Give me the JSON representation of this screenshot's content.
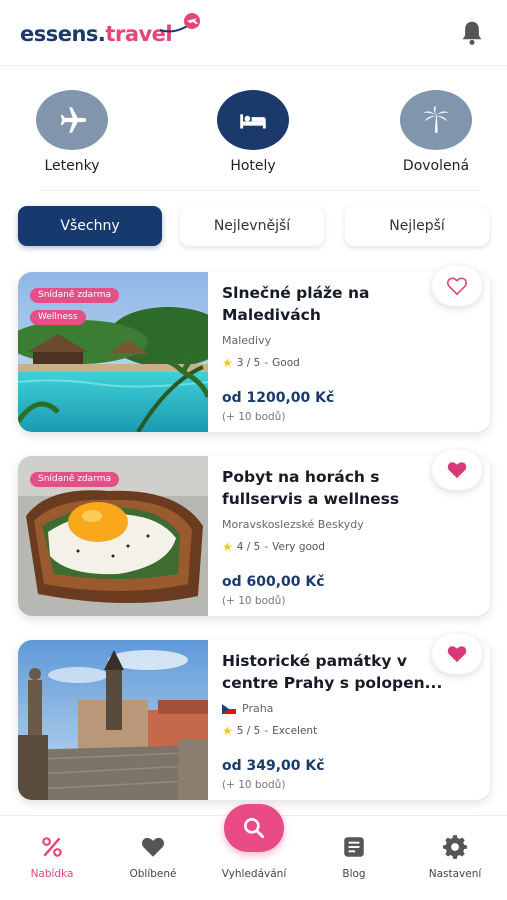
{
  "header": {
    "logo_part1": "essens.",
    "logo_part2": "travel"
  },
  "categories": [
    {
      "label": "Letenky",
      "icon": "airplane-icon",
      "active": false
    },
    {
      "label": "Hotely",
      "icon": "bed-icon",
      "active": true
    },
    {
      "label": "Dovolená",
      "icon": "palm-tree-icon",
      "active": false
    }
  ],
  "filters": [
    {
      "label": "Všechny",
      "active": true
    },
    {
      "label": "Nejlevnější",
      "active": false
    },
    {
      "label": "Nejlepší",
      "active": false
    }
  ],
  "offers": [
    {
      "badges": [
        "Snídaně zdarma",
        "Wellness"
      ],
      "title": "Slnečné pláže na Maledivách",
      "location": "Maledivy",
      "rating": "3 / 5",
      "rating_text": "Good",
      "price": "od 1200,00 Kč",
      "points": "(+ 10 bodů)",
      "favorite": false
    },
    {
      "badges": [
        "Snídaně zdarma"
      ],
      "title": "Pobyt na horách s fullservis a wellness",
      "location": "Moravskoslezské Beskydy",
      "rating": "4 / 5",
      "rating_text": "Very good",
      "price": "od 600,00 Kč",
      "points": "(+ 10 bodů)",
      "favorite": true
    },
    {
      "badges": [],
      "title": "Historické památky v centre Prahy s polopen...",
      "location": "Praha",
      "rating": "5 / 5",
      "rating_text": "Excelent",
      "price": "od 349,00 Kč",
      "points": "(+ 10 bodů)",
      "favorite": true
    }
  ],
  "bottom_nav": [
    {
      "label": "Nabídka",
      "icon": "percent-icon",
      "active": true
    },
    {
      "label": "Oblíbené",
      "icon": "heart-icon",
      "active": false
    },
    {
      "label": "Vyhledávání",
      "icon": "search-icon",
      "active": false
    },
    {
      "label": "Blog",
      "icon": "blog-icon",
      "active": false
    },
    {
      "label": "Nastavení",
      "icon": "gear-icon",
      "active": false
    }
  ],
  "colors": {
    "brand_navy": "#1b3a6b",
    "brand_pink": "#e5457a",
    "icon_inactive": "#8196ad"
  }
}
